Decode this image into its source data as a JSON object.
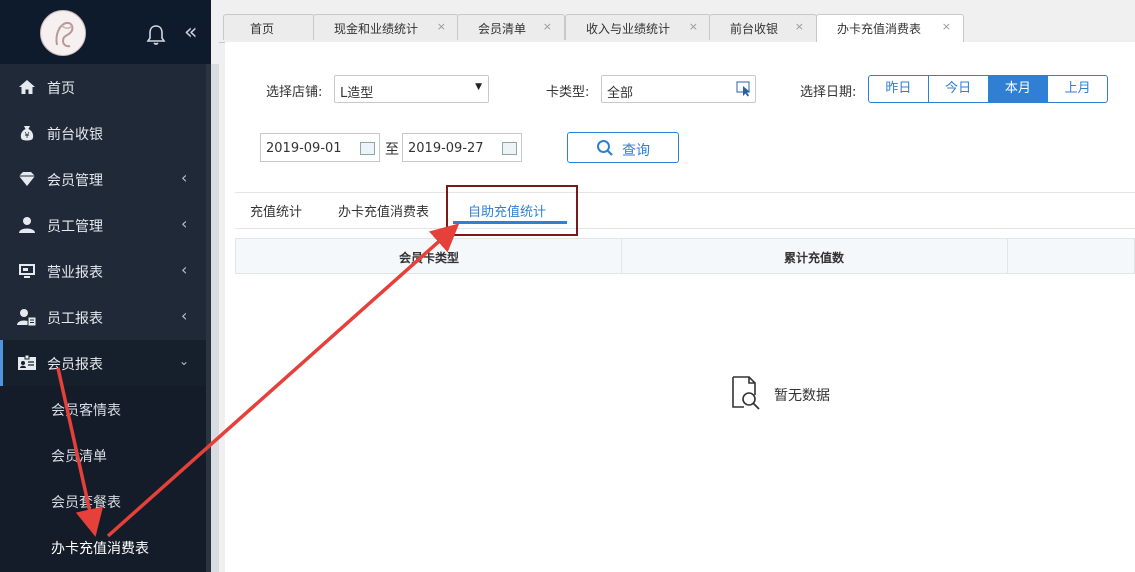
{
  "sidebar": {
    "items": [
      {
        "label": "首页",
        "icon": "home-icon"
      },
      {
        "label": "前台收银",
        "icon": "money-bag-icon"
      },
      {
        "label": "会员管理",
        "icon": "diamond-icon"
      },
      {
        "label": "员工管理",
        "icon": "user-icon"
      },
      {
        "label": "营业报表",
        "icon": "monitor-icon"
      },
      {
        "label": "员工报表",
        "icon": "user-report-icon"
      },
      {
        "label": "会员报表",
        "icon": "id-card-icon"
      }
    ],
    "sub_items": [
      "会员客情表",
      "会员清单",
      "会员套餐表",
      "办卡充值消费表"
    ]
  },
  "tabs": [
    {
      "label": "首页"
    },
    {
      "label": "现金和业绩统计",
      "close": "×"
    },
    {
      "label": "会员清单",
      "close": "×"
    },
    {
      "label": "收入与业绩统计",
      "close": "×"
    },
    {
      "label": "前台收银",
      "close": "×"
    },
    {
      "label": "办卡充值消费表",
      "close": "×"
    }
  ],
  "filters": {
    "store_label": "选择店铺:",
    "store_value": "L造型",
    "card_type_label": "卡类型:",
    "card_type_value": "全部",
    "date_label": "选择日期:",
    "date_options": [
      "昨日",
      "今日",
      "本月",
      "上月"
    ],
    "date_selected": "本月",
    "start_date": "2019-09-01",
    "to_label": "至",
    "end_date": "2019-09-27",
    "query_label": "查询"
  },
  "subtabs": [
    "充值统计",
    "办卡充值消费表",
    "自助充值统计"
  ],
  "subtab_active": "自助充值统计",
  "table": {
    "headers": [
      "会员卡类型",
      "累计充值数"
    ]
  },
  "empty_text": "暂无数据",
  "colors": {
    "accent": "#2f7fd3",
    "sidebar": "#1f2937",
    "annotation": "#e5403a"
  }
}
